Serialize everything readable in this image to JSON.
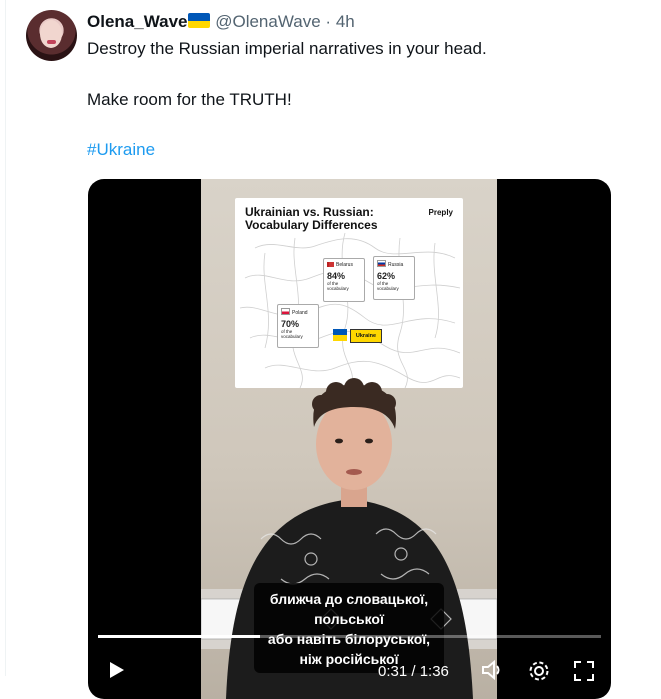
{
  "tweet": {
    "author_name": "Olena_Wave",
    "author_handle": "@OlenaWave",
    "separator": "·",
    "time_ago": "4h",
    "line1": "Destroy the Russian imperial narratives in your head.",
    "line2": "Make room for the TRUTH!",
    "hashtag": "#Ukraine"
  },
  "video": {
    "card_title": "Ukrainian vs. Russian: Vocabulary Differences",
    "card_brand": "Preply",
    "stats": [
      {
        "country": "Belarus",
        "percent": "84%",
        "note": "of the vocabulary"
      },
      {
        "country": "Russia",
        "percent": "62%",
        "note": "of the vocabulary"
      },
      {
        "country": "Poland",
        "percent": "70%",
        "note": "of the vocabulary"
      }
    ],
    "ukraine_label": "Ukraine",
    "subtitles": [
      "ближча до словацької,",
      "польської",
      "або навіть білоруської,",
      "ніж російської"
    ],
    "timecode": "0:31 / 1:36",
    "progress_fraction": 0.323
  },
  "colors": {
    "hashtag": "#1d9bf0",
    "muted": "#536471",
    "flag_blue": "#0057b7",
    "flag_yellow": "#ffd700"
  },
  "icons": [
    "ukraine-flag-icon",
    "play-icon",
    "volume-icon",
    "settings-icon",
    "fullscreen-icon"
  ]
}
